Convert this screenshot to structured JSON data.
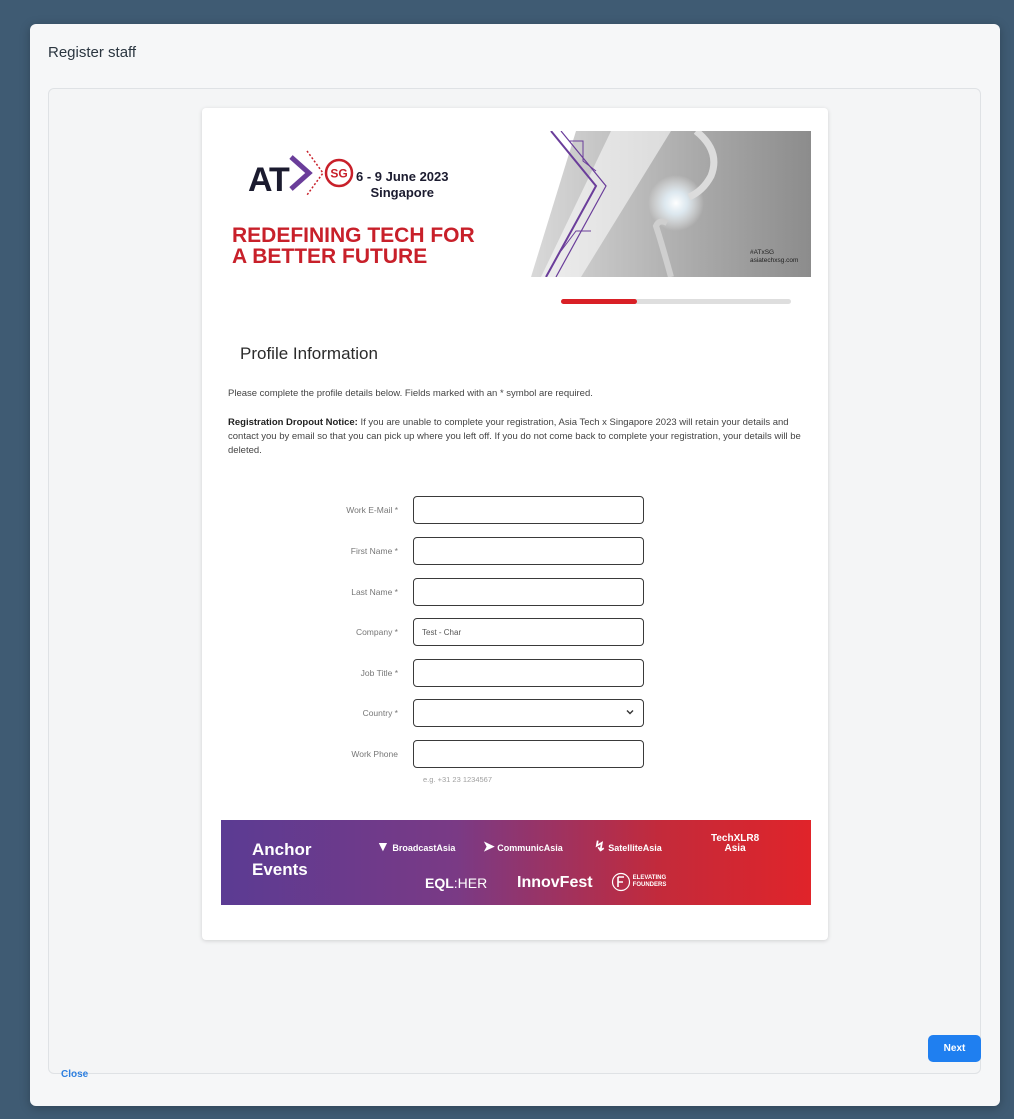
{
  "modal": {
    "title": "Register staff"
  },
  "banner": {
    "logo_text": "AT",
    "logo_badge": "SG",
    "dates": "6 - 9 June 2023",
    "location": "Singapore",
    "headline_1": "REDEFINING TECH FOR",
    "headline_2": "A BETTER FUTURE",
    "hashtag": "#ATxSG",
    "website": "asiatechxsg.com"
  },
  "progress": {
    "fraction": 0.33,
    "color": "#d92026"
  },
  "profile": {
    "title": "Profile Information",
    "intro": "Please complete the profile details below. Fields marked with an * symbol are required.",
    "notice_label": "Registration Dropout Notice:",
    "notice_text": " If you are unable to complete your registration, Asia Tech x Singapore 2023 will retain your details and contact you by email so that you can pick up where you left off. If you do not come back to complete your registration, your details will be deleted."
  },
  "fields": {
    "work_email": {
      "label": "Work E-Mail *",
      "value": ""
    },
    "first_name": {
      "label": "First Name *",
      "value": ""
    },
    "last_name": {
      "label": "Last Name *",
      "value": ""
    },
    "company": {
      "label": "Company *",
      "value": "Test - Char"
    },
    "job_title": {
      "label": "Job Title *",
      "value": ""
    },
    "country": {
      "label": "Country *",
      "value": ""
    },
    "work_phone": {
      "label": "Work Phone",
      "value": "",
      "hint": "e.g. +31 23 1234567"
    }
  },
  "anchor": {
    "title_1": "Anchor",
    "title_2": "Events",
    "events": [
      "BroadcastAsia",
      "CommunicAsia",
      "SatelliteAsia",
      "TechXLR8",
      "Asia",
      "EQL",
      "HER",
      "InnovFest",
      "ELEVATING",
      "FOUNDERS"
    ]
  },
  "footer": {
    "close_label": "Close",
    "next_label": "Next"
  },
  "colors": {
    "accent": "#1f7ff0",
    "brand_red": "#c8202a",
    "brand_purple": "#5b3b93"
  }
}
